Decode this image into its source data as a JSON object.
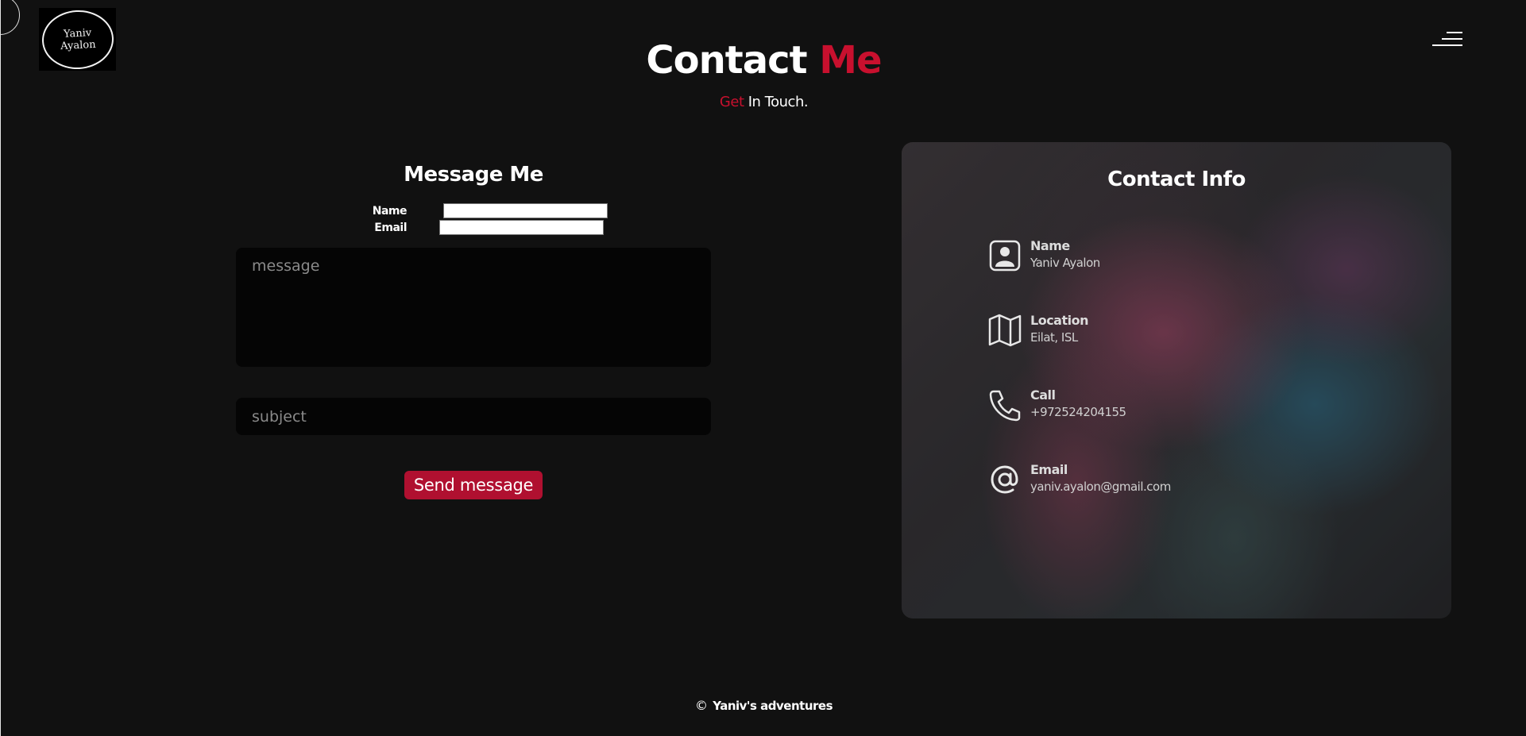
{
  "header": {
    "logo_line1": "Yaniv",
    "logo_line2": "Ayalon",
    "title_main": "Contact",
    "title_accent": "Me",
    "subtitle_accent": "Get",
    "subtitle_rest": "In Touch."
  },
  "form": {
    "heading": "Message Me",
    "name_label": "Name",
    "email_label": "Email",
    "name_value": "",
    "email_value": "",
    "message_placeholder": "message",
    "subject_placeholder": "subject",
    "send_label": "Send message"
  },
  "contact_info": {
    "heading": "Contact Info",
    "items": [
      {
        "label": "Name",
        "value": "Yaniv Ayalon",
        "icon": "person-icon"
      },
      {
        "label": "Location",
        "value": "Eilat, ISL",
        "icon": "map-icon"
      },
      {
        "label": "Call",
        "value": "+972524204155",
        "icon": "phone-icon"
      },
      {
        "label": "Email",
        "value": "yaniv.ayalon@gmail.com",
        "icon": "at-sign-icon"
      }
    ]
  },
  "footer": {
    "text": "Yaniv's adventures",
    "icon": "copyright-icon"
  },
  "colors": {
    "background": "#111111",
    "accent": "#c8102e",
    "button": "#b01030"
  }
}
